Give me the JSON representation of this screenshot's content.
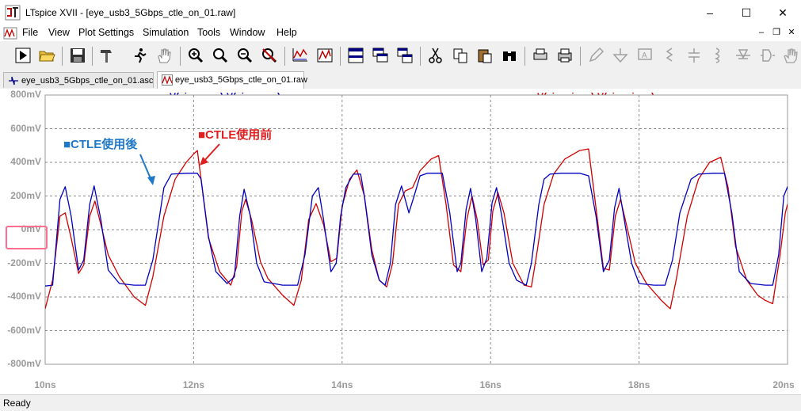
{
  "window": {
    "title": "LTspice XVII - [eye_usb3_5Gbps_ctle_on_01.raw]",
    "minimize_icon": "minimize-icon",
    "maximize_icon": "maximize-icon",
    "close_icon": "close-icon"
  },
  "menu": {
    "items": [
      {
        "label": "File"
      },
      {
        "label": "View"
      },
      {
        "label": "Plot Settings"
      },
      {
        "label": "Simulation"
      },
      {
        "label": "Tools"
      },
      {
        "label": "Window"
      },
      {
        "label": "Help"
      }
    ]
  },
  "tabs": [
    {
      "label": "eye_usb3_5Gbps_ctle_on_01.asc",
      "icon": "schematic-icon"
    },
    {
      "label": "eye_usb3_5Gbps_ctle_on_01.raw",
      "icon": "waveform-icon"
    }
  ],
  "plot": {
    "trace1_title": "V(vin_eq_p)-V(vin_eq_n)",
    "trace2_title": "V(vin_pin_p)-V(vin_pin_n)",
    "trace1_color": "#0000c0",
    "trace2_color": "#d00000",
    "annotation_after": "■CTLE使用後",
    "annotation_before": "■CTLE使用前",
    "y_ticks": [
      "800mV",
      "600mV",
      "400mV",
      "200mV",
      "0mV",
      "-200mV",
      "-400mV",
      "-600mV",
      "-800mV"
    ],
    "x_ticks": [
      "10ns",
      "12ns",
      "14ns",
      "16ns",
      "18ns",
      "20ns"
    ]
  },
  "chart_data": {
    "type": "line",
    "xlabel": "",
    "ylabel": "",
    "x_unit": "ns",
    "y_unit": "mV",
    "xlim": [
      10,
      20
    ],
    "ylim": [
      -800,
      800
    ],
    "grid": true,
    "series": [
      {
        "name": "V(vin_eq_p)-V(vin_eq_n)",
        "color": "#0000c0",
        "points": [
          [
            10.0,
            -335
          ],
          [
            10.1,
            -330
          ],
          [
            10.2,
            180
          ],
          [
            10.27,
            255
          ],
          [
            10.35,
            80
          ],
          [
            10.45,
            -240
          ],
          [
            10.52,
            -180
          ],
          [
            10.6,
            150
          ],
          [
            10.66,
            260
          ],
          [
            10.75,
            60
          ],
          [
            10.85,
            -240
          ],
          [
            11.0,
            -320
          ],
          [
            11.2,
            -330
          ],
          [
            11.35,
            -330
          ],
          [
            11.45,
            -180
          ],
          [
            11.6,
            250
          ],
          [
            11.7,
            330
          ],
          [
            11.9,
            335
          ],
          [
            12.05,
            335
          ],
          [
            12.1,
            300
          ],
          [
            12.2,
            -40
          ],
          [
            12.3,
            -250
          ],
          [
            12.45,
            -320
          ],
          [
            12.55,
            -280
          ],
          [
            12.62,
            80
          ],
          [
            12.68,
            240
          ],
          [
            12.76,
            90
          ],
          [
            12.85,
            -200
          ],
          [
            12.95,
            -310
          ],
          [
            13.2,
            -330
          ],
          [
            13.4,
            -330
          ],
          [
            13.5,
            -150
          ],
          [
            13.6,
            200
          ],
          [
            13.68,
            250
          ],
          [
            13.75,
            60
          ],
          [
            13.85,
            -250
          ],
          [
            13.92,
            -200
          ],
          [
            13.98,
            80
          ],
          [
            14.05,
            250
          ],
          [
            14.15,
            330
          ],
          [
            14.25,
            330
          ],
          [
            14.3,
            200
          ],
          [
            14.4,
            -150
          ],
          [
            14.5,
            -300
          ],
          [
            14.58,
            -330
          ],
          [
            14.65,
            -200
          ],
          [
            14.72,
            150
          ],
          [
            14.8,
            260
          ],
          [
            14.9,
            100
          ],
          [
            14.97,
            200
          ],
          [
            15.05,
            320
          ],
          [
            15.15,
            335
          ],
          [
            15.35,
            335
          ],
          [
            15.45,
            100
          ],
          [
            15.55,
            -250
          ],
          [
            15.6,
            -200
          ],
          [
            15.67,
            120
          ],
          [
            15.73,
            245
          ],
          [
            15.8,
            60
          ],
          [
            15.88,
            -250
          ],
          [
            15.95,
            -170
          ],
          [
            16.02,
            160
          ],
          [
            16.08,
            250
          ],
          [
            16.15,
            80
          ],
          [
            16.25,
            -200
          ],
          [
            16.35,
            -300
          ],
          [
            16.48,
            -330
          ],
          [
            16.55,
            -200
          ],
          [
            16.65,
            150
          ],
          [
            16.72,
            300
          ],
          [
            16.8,
            330
          ],
          [
            16.95,
            335
          ],
          [
            17.2,
            335
          ],
          [
            17.32,
            320
          ],
          [
            17.42,
            80
          ],
          [
            17.52,
            -250
          ],
          [
            17.6,
            -180
          ],
          [
            17.67,
            130
          ],
          [
            17.73,
            245
          ],
          [
            17.8,
            60
          ],
          [
            17.9,
            -200
          ],
          [
            18.0,
            -320
          ],
          [
            18.2,
            -330
          ],
          [
            18.35,
            -330
          ],
          [
            18.45,
            -180
          ],
          [
            18.55,
            100
          ],
          [
            18.7,
            300
          ],
          [
            18.8,
            330
          ],
          [
            19.0,
            335
          ],
          [
            19.15,
            335
          ],
          [
            19.25,
            100
          ],
          [
            19.35,
            -250
          ],
          [
            19.5,
            -320
          ],
          [
            19.7,
            -330
          ],
          [
            19.8,
            -330
          ],
          [
            19.88,
            -150
          ],
          [
            19.95,
            200
          ],
          [
            20.0,
            255
          ],
          [
            20.05,
            120
          ],
          [
            20.15,
            -100
          ]
        ]
      },
      {
        "name": "V(vin_pin_p)-V(vin_pin_n)",
        "color": "#d00000",
        "points": [
          [
            10.0,
            -470
          ],
          [
            10.1,
            -300
          ],
          [
            10.2,
            80
          ],
          [
            10.27,
            100
          ],
          [
            10.35,
            -50
          ],
          [
            10.45,
            -260
          ],
          [
            10.52,
            -210
          ],
          [
            10.6,
            80
          ],
          [
            10.67,
            170
          ],
          [
            10.75,
            30
          ],
          [
            10.85,
            -150
          ],
          [
            11.0,
            -280
          ],
          [
            11.2,
            -400
          ],
          [
            11.35,
            -450
          ],
          [
            11.45,
            -280
          ],
          [
            11.6,
            80
          ],
          [
            11.75,
            300
          ],
          [
            11.9,
            400
          ],
          [
            12.0,
            450
          ],
          [
            12.05,
            470
          ],
          [
            12.1,
            300
          ],
          [
            12.2,
            -50
          ],
          [
            12.35,
            -250
          ],
          [
            12.5,
            -330
          ],
          [
            12.58,
            -220
          ],
          [
            12.65,
            110
          ],
          [
            12.7,
            180
          ],
          [
            12.78,
            60
          ],
          [
            12.9,
            -190
          ],
          [
            13.0,
            -290
          ],
          [
            13.2,
            -390
          ],
          [
            13.35,
            -450
          ],
          [
            13.45,
            -300
          ],
          [
            13.55,
            60
          ],
          [
            13.65,
            155
          ],
          [
            13.75,
            30
          ],
          [
            13.85,
            -190
          ],
          [
            13.93,
            -170
          ],
          [
            14.0,
            140
          ],
          [
            14.1,
            300
          ],
          [
            14.2,
            355
          ],
          [
            14.3,
            200
          ],
          [
            14.4,
            -120
          ],
          [
            14.5,
            -300
          ],
          [
            14.6,
            -340
          ],
          [
            14.68,
            -200
          ],
          [
            14.76,
            150
          ],
          [
            14.85,
            230
          ],
          [
            14.95,
            250
          ],
          [
            15.05,
            350
          ],
          [
            15.2,
            420
          ],
          [
            15.3,
            440
          ],
          [
            15.4,
            150
          ],
          [
            15.5,
            -210
          ],
          [
            15.6,
            -250
          ],
          [
            15.68,
            60
          ],
          [
            15.75,
            200
          ],
          [
            15.82,
            60
          ],
          [
            15.9,
            -210
          ],
          [
            15.97,
            -180
          ],
          [
            16.03,
            110
          ],
          [
            16.1,
            220
          ],
          [
            16.18,
            100
          ],
          [
            16.3,
            -200
          ],
          [
            16.45,
            -330
          ],
          [
            16.55,
            -340
          ],
          [
            16.62,
            -150
          ],
          [
            16.72,
            150
          ],
          [
            16.85,
            330
          ],
          [
            17.0,
            420
          ],
          [
            17.2,
            470
          ],
          [
            17.32,
            480
          ],
          [
            17.4,
            200
          ],
          [
            17.52,
            -230
          ],
          [
            17.6,
            -240
          ],
          [
            17.68,
            80
          ],
          [
            17.75,
            180
          ],
          [
            17.82,
            50
          ],
          [
            17.95,
            -200
          ],
          [
            18.1,
            -320
          ],
          [
            18.3,
            -420
          ],
          [
            18.42,
            -470
          ],
          [
            18.5,
            -300
          ],
          [
            18.65,
            80
          ],
          [
            18.8,
            300
          ],
          [
            18.95,
            400
          ],
          [
            19.1,
            430
          ],
          [
            19.2,
            250
          ],
          [
            19.3,
            -100
          ],
          [
            19.45,
            -300
          ],
          [
            19.6,
            -390
          ],
          [
            19.7,
            -420
          ],
          [
            19.8,
            -440
          ],
          [
            19.9,
            -150
          ],
          [
            19.97,
            100
          ],
          [
            20.0,
            150
          ],
          [
            20.05,
            60
          ],
          [
            20.15,
            -150
          ]
        ]
      }
    ]
  }
}
